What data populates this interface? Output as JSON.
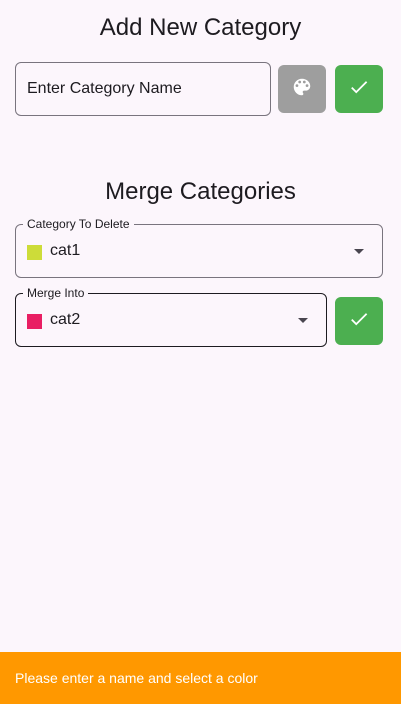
{
  "add_section": {
    "title": "Add New Category",
    "name_placeholder": "Enter Category Name",
    "palette_button_icon": "palette-icon",
    "palette_button_color": "#9e9e9e",
    "confirm_button_icon": "check-icon",
    "confirm_button_color": "#4caf50"
  },
  "merge_section": {
    "title": "Merge Categories",
    "delete_dropdown": {
      "label": "Category To Delete",
      "value": "cat1",
      "color": "#cddc39"
    },
    "merge_into_dropdown": {
      "label": "Merge Into",
      "value": "cat2",
      "color": "#e91e63"
    },
    "confirm_button_icon": "check-icon",
    "confirm_button_color": "#4caf50"
  },
  "snackbar": {
    "message": "Please enter a name and select a color",
    "color": "#ff9800"
  }
}
